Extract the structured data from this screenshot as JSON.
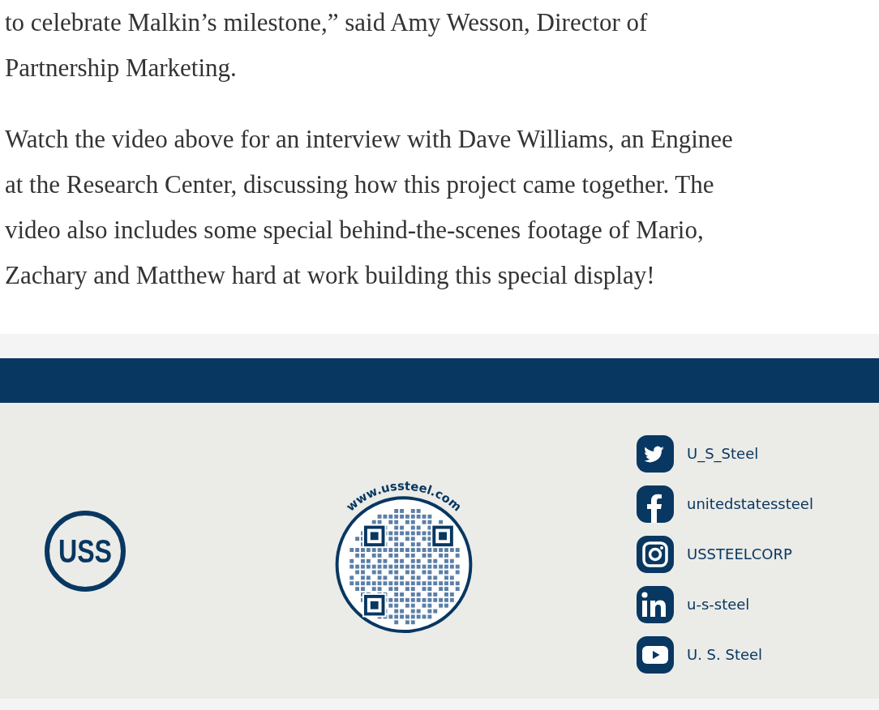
{
  "article": {
    "paragraphs": [
      {
        "lines": [
          "to celebrate Malkin’s milestone,” said Amy Wesson, Director of",
          "Partnership Marketing."
        ]
      },
      {
        "lines": [
          "Watch the video above for an interview with Dave Williams, an Enginee",
          "at the Research Center, discussing how this project came together. The",
          "video also includes some special behind-the-scenes footage of Mario,",
          "Zachary and Matthew hard at work building this special display!"
        ]
      }
    ]
  },
  "footer": {
    "logo": {
      "text": "USS"
    },
    "qr": {
      "caption": "www.ussteel.com"
    },
    "social": [
      {
        "kind": "twitter",
        "handle": "U_S_Steel"
      },
      {
        "kind": "facebook",
        "handle": "unitedstatessteel"
      },
      {
        "kind": "instagram",
        "handle": "USSTEELCORP"
      },
      {
        "kind": "linkedin",
        "handle": "u-s-steel"
      },
      {
        "kind": "youtube",
        "handle": "U. S. Steel"
      }
    ]
  }
}
